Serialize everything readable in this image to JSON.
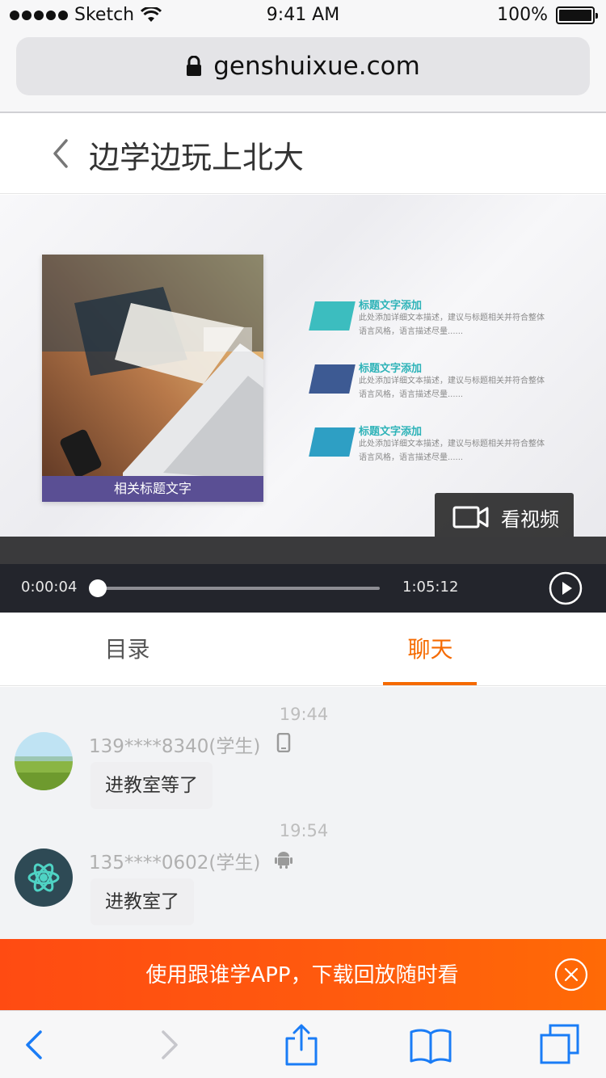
{
  "status_bar": {
    "carrier": "Sketch",
    "time": "9:41 AM",
    "battery": "100%",
    "battery_level": 1.0
  },
  "browser": {
    "url": "genshuixue.com"
  },
  "header": {
    "title": "边学边玩上北大"
  },
  "video": {
    "slide": {
      "caption": "相关标题文字",
      "items": [
        {
          "title": "标题文字添加",
          "desc": "此处添加详细文本描述，建议与标题相关并符合整体语言风格，语言描述尽量......",
          "color": "#3cbdbf"
        },
        {
          "title": "标题文字添加",
          "desc": "此处添加详细文本描述，建议与标题相关并符合整体语言风格，语言描述尽量......",
          "color": "#3d5a93"
        },
        {
          "title": "标题文字添加",
          "desc": "此处添加详细文本描述，建议与标题相关并符合整体语言风格，语言描述尽量......",
          "color": "#2e9fc4"
        }
      ]
    },
    "watch_label": "看视频",
    "current_time": "0:00:04",
    "total_time": "1:05:12",
    "progress": 0.001
  },
  "tabs": [
    {
      "label": "目录",
      "active": false
    },
    {
      "label": "聊天",
      "active": true
    }
  ],
  "accent_color": "#f56a00",
  "chat": {
    "messages": [
      {
        "time": "19:44",
        "sender": "139****8340(学生)",
        "device_icon": "phone-icon",
        "text": "进教室等了"
      },
      {
        "time": "19:54",
        "sender": "135****0602(学生)",
        "device_icon": "android-icon",
        "text": "进教室了"
      }
    ]
  },
  "app_banner": {
    "text": "使用跟谁学APP，下载回放随时看",
    "color": "#ff5a0e"
  },
  "toolbar": {
    "icons": [
      "back-icon",
      "forward-icon",
      "share-icon",
      "bookmarks-icon",
      "tabs-icon"
    ]
  }
}
